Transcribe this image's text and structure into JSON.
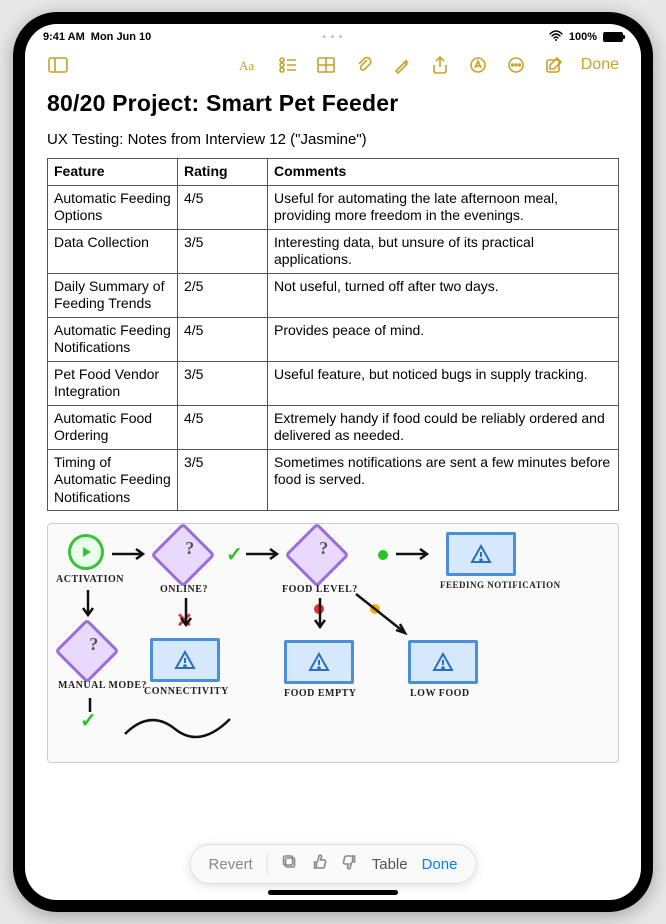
{
  "status": {
    "time": "9:41 AM",
    "date": "Mon Jun 10",
    "battery_pct": "100%"
  },
  "toolbar": {
    "done": "Done"
  },
  "note": {
    "title": "80/20 Project: Smart Pet Feeder",
    "subtitle": "UX Testing: Notes from Interview 12 (\"Jasmine\")"
  },
  "table": {
    "headers": [
      "Feature",
      "Rating",
      "Comments"
    ],
    "rows": [
      {
        "feature": "Automatic Feeding Options",
        "rating": "4/5",
        "comment": "Useful for automating the late afternoon meal, providing more freedom in the evenings."
      },
      {
        "feature": "Data Collection",
        "rating": "3/5",
        "comment": "Interesting data, but unsure of its practical applications."
      },
      {
        "feature": "Daily Summary of Feeding Trends",
        "rating": "2/5",
        "comment": "Not useful, turned off after two days."
      },
      {
        "feature": "Automatic Feeding Notifications",
        "rating": "4/5",
        "comment": "Provides peace of mind."
      },
      {
        "feature": "Pet Food Vendor Integration",
        "rating": "3/5",
        "comment": "Useful feature, but noticed bugs in supply tracking."
      },
      {
        "feature": "Automatic Food Ordering",
        "rating": "4/5",
        "comment": "Extremely handy if food could be reliably ordered and delivered as needed."
      },
      {
        "feature": "Timing of Automatic Feeding Notifications",
        "rating": "3/5",
        "comment": "Sometimes notifications are sent a few minutes before food is served."
      }
    ]
  },
  "sketch": {
    "nodes": {
      "activation": "ACTIVATION",
      "online": "ONLINE?",
      "manual": "MANUAL MODE?",
      "connectivity": "CONNECTIVITY",
      "foodlevel": "FOOD LEVEL?",
      "foodempty": "FOOD EMPTY",
      "lowfood": "LOW FOOD",
      "feednotif": "FEEDING NOTIFICATION"
    }
  },
  "floatbar": {
    "revert": "Revert",
    "label": "Table",
    "done": "Done"
  }
}
